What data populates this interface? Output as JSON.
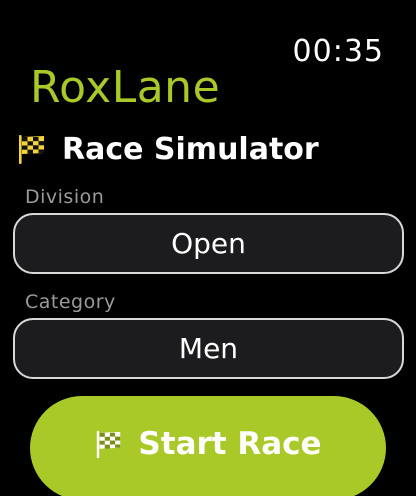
{
  "status": {
    "time": "00:35"
  },
  "app": {
    "title": "RoxLane"
  },
  "header": {
    "icon": "chequered-flag-icon",
    "title": "Race Simulator"
  },
  "fields": {
    "division": {
      "label": "Division",
      "value": "Open"
    },
    "category": {
      "label": "Category",
      "value": "Men"
    }
  },
  "actions": {
    "start": {
      "icon": "chequered-flag-icon",
      "label": "Start Race"
    }
  },
  "colors": {
    "accent": "#a8c927",
    "background": "#000000",
    "label": "#9a9a9a",
    "picker_border": "#d8d8d8",
    "picker_fill": "#1c1c1e",
    "flag_yellow": "#f5d43a"
  }
}
